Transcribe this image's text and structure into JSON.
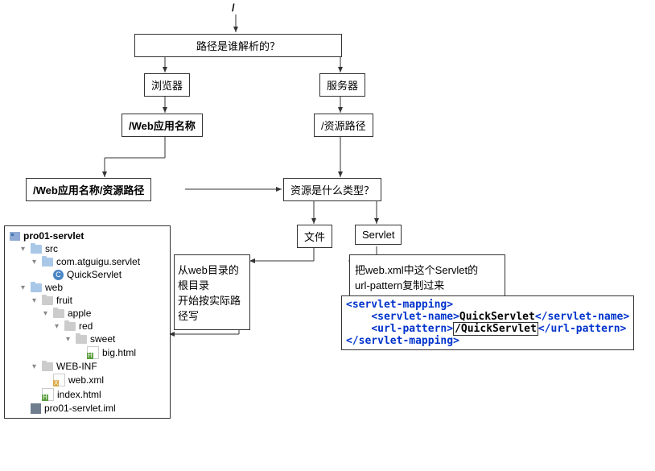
{
  "root_slash": "/",
  "nodes": {
    "q1": "路径是谁解析的？",
    "browser": "浏览器",
    "server": "服务器",
    "webapp_name": "/Web应用名称",
    "resource_path": "/资源路径",
    "webapp_resource_path": "/Web应用名称/资源路径",
    "resource_type": "资源是什么类型？",
    "file": "文件",
    "servlet": "Servlet",
    "from_web_root": "从web目录的根目录\n开始按实际路径写",
    "url_pattern_desc": "把web.xml中这个Servlet的\nurl-pattern复制过来"
  },
  "tree": {
    "root": "pro01-servlet",
    "src": "src",
    "pkg": "com.atguigu.servlet",
    "class_letter": "C",
    "class_name": "QuickServlet",
    "web": "web",
    "fruit": "fruit",
    "apple": "apple",
    "red": "red",
    "sweet": "sweet",
    "big_html": "big.html",
    "web_inf": "WEB-INF",
    "web_xml": "web.xml",
    "index_html": "index.html",
    "iml": "pro01-servlet.iml"
  },
  "code": {
    "l1_open": "<servlet-mapping>",
    "l2_open": "<servlet-name>",
    "l2_text": "QuickServlet",
    "l2_close": "</servlet-name>",
    "l3_open": "<url-pattern>",
    "l3_text": "/QuickServlet",
    "l3_close": "</url-pattern>",
    "l4_close": "</servlet-mapping>"
  }
}
